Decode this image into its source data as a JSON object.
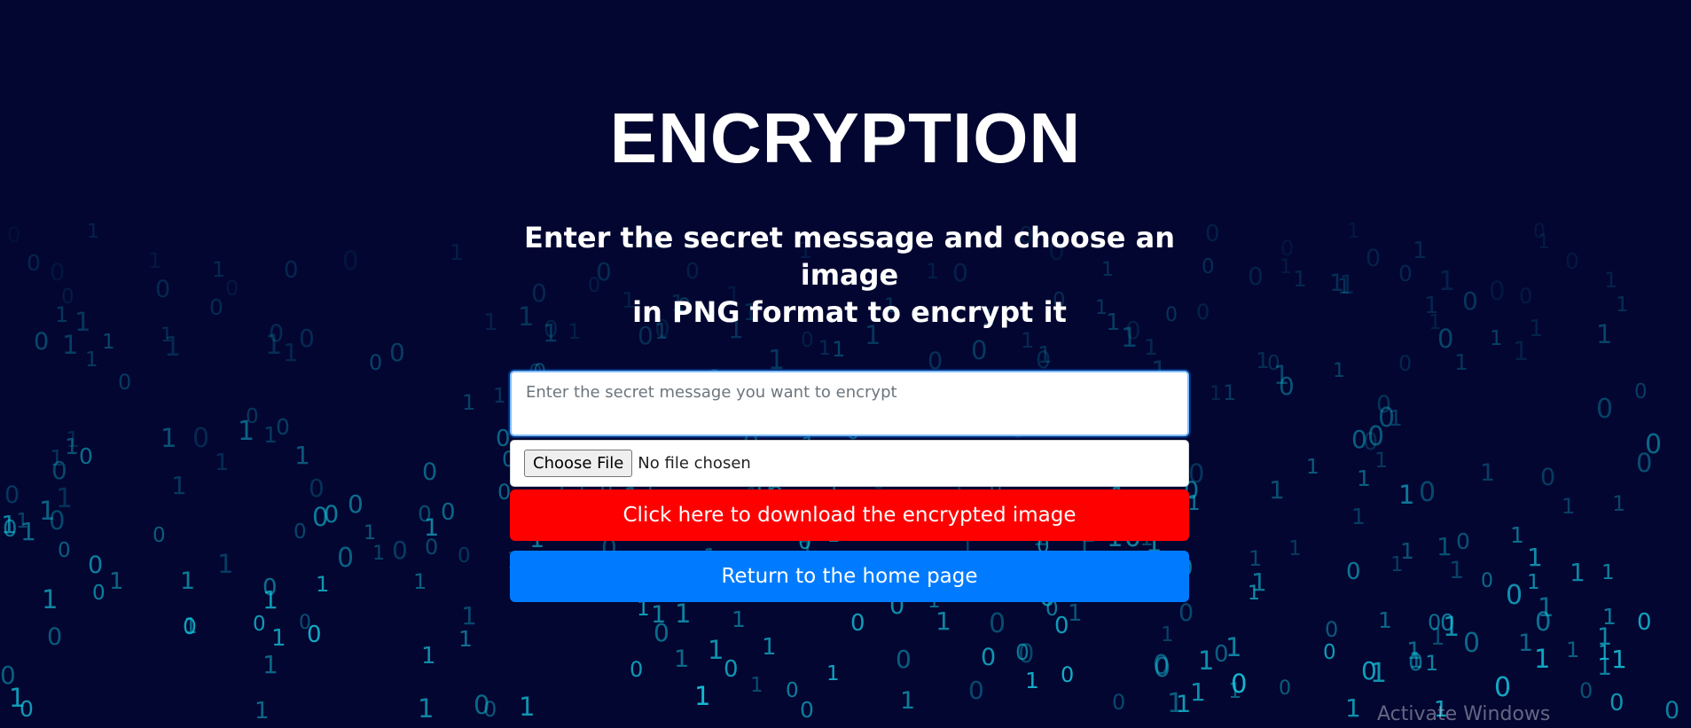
{
  "page": {
    "title": "ENCRYPTION",
    "subtitle_line1": "Enter the secret message and choose an image",
    "subtitle_line2": "in PNG format to encrypt it"
  },
  "form": {
    "message_placeholder": "Enter the secret message you want to encrypt",
    "message_value": "",
    "choose_file_label": "Choose File",
    "file_status": "No file chosen",
    "download_label": "Click here to download the encrypted image",
    "home_label": "Return to the home page"
  },
  "overlay": {
    "watermark": "Activate Windows"
  },
  "background": {
    "glyphs": [
      "0",
      "1"
    ]
  },
  "colors": {
    "page_background": "#020631",
    "glyph": "#15c4dc",
    "download_button": "#ff0000",
    "home_button": "#007bff"
  }
}
